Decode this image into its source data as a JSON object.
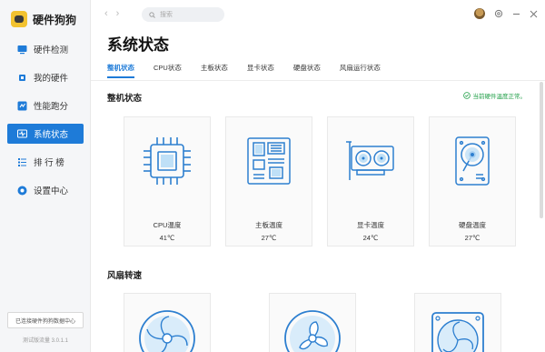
{
  "app": {
    "name": "硬件狗狗",
    "version": "测试版流量 3.0.1.1",
    "bottom_button": "已连接硬件狗狗数据中心"
  },
  "sidebar": {
    "items": [
      {
        "label": "硬件检测",
        "icon": "monitor-icon",
        "active": false
      },
      {
        "label": "我的硬件",
        "icon": "cpu-chip-icon",
        "active": false
      },
      {
        "label": "性能跑分",
        "icon": "benchmark-icon",
        "active": false
      },
      {
        "label": "系统状态",
        "icon": "heartbeat-icon",
        "active": true
      },
      {
        "label": "排 行 榜",
        "icon": "ranking-icon",
        "active": false
      },
      {
        "label": "设置中心",
        "icon": "settings-icon",
        "active": false
      }
    ]
  },
  "search": {
    "placeholder": "搜索"
  },
  "page": {
    "title": "系统状态",
    "tabs": [
      {
        "label": "整机状态",
        "active": true
      },
      {
        "label": "CPU状态",
        "active": false
      },
      {
        "label": "主板状态",
        "active": false
      },
      {
        "label": "显卡状态",
        "active": false
      },
      {
        "label": "硬盘状态",
        "active": false
      },
      {
        "label": "风扇运行状态",
        "active": false
      }
    ]
  },
  "overview": {
    "title": "整机状态",
    "status_note": "当前硬件温度正常。",
    "status_color": "#23a04a",
    "cards": [
      {
        "label": "CPU温度",
        "temp": "41℃",
        "icon": "cpu-icon"
      },
      {
        "label": "主板温度",
        "temp": "27℃",
        "icon": "motherboard-icon"
      },
      {
        "label": "显卡温度",
        "temp": "24℃",
        "icon": "graphics-card-icon"
      },
      {
        "label": "硬盘温度",
        "temp": "27℃",
        "icon": "hard-disk-icon"
      }
    ]
  },
  "fans": {
    "title": "风扇转速",
    "cards": [
      {
        "icon": "fan-icon"
      },
      {
        "icon": "fan-icon"
      },
      {
        "icon": "case-fan-icon"
      }
    ]
  },
  "colors": {
    "accent": "#1e7bd8",
    "icon_blue": "#2d7fd0"
  }
}
